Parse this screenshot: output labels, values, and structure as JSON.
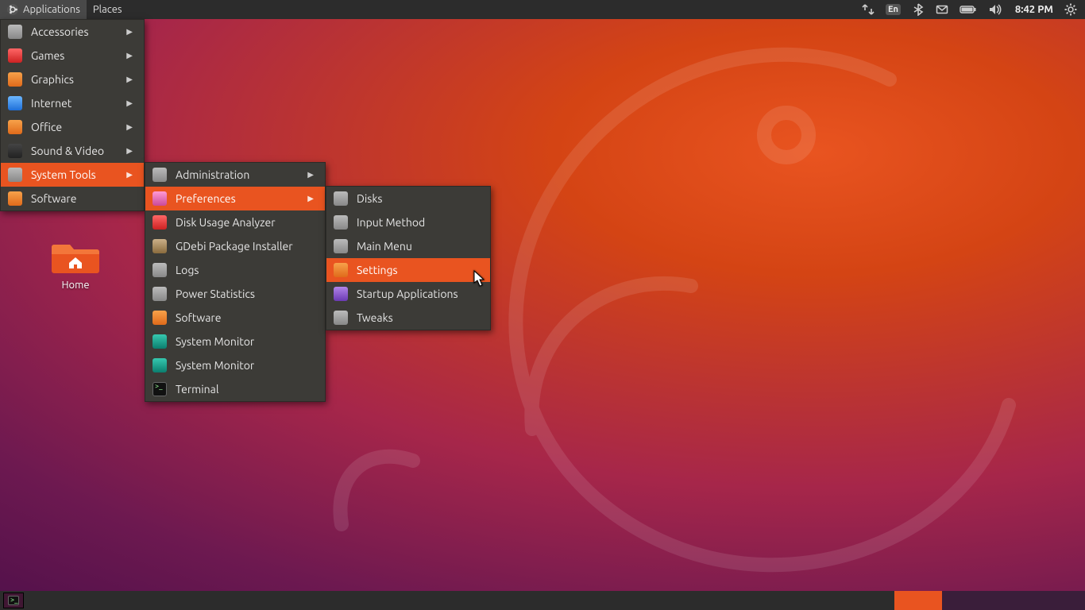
{
  "topbar": {
    "applications": "Applications",
    "places": "Places",
    "lang": "En",
    "clock": "8:42 PM"
  },
  "desktop": {
    "home_label": "Home"
  },
  "apps_menu": {
    "items": [
      {
        "label": "Accessories",
        "arrow": true,
        "icon": "ic-grey"
      },
      {
        "label": "Games",
        "arrow": true,
        "icon": "ic-red"
      },
      {
        "label": "Graphics",
        "arrow": true,
        "icon": "ic-orange"
      },
      {
        "label": "Internet",
        "arrow": true,
        "icon": "ic-blue"
      },
      {
        "label": "Office",
        "arrow": true,
        "icon": "ic-orange"
      },
      {
        "label": "Sound & Video",
        "arrow": true,
        "icon": "ic-dark"
      },
      {
        "label": "System Tools",
        "arrow": true,
        "icon": "ic-grey",
        "highlight": true
      },
      {
        "label": "Software",
        "arrow": false,
        "icon": "ic-orange"
      }
    ]
  },
  "systools_menu": {
    "items": [
      {
        "label": "Administration",
        "arrow": true,
        "icon": "ic-grey"
      },
      {
        "label": "Preferences",
        "arrow": true,
        "icon": "ic-pink",
        "highlight": true
      },
      {
        "label": "Disk Usage Analyzer",
        "arrow": false,
        "icon": "ic-red"
      },
      {
        "label": "GDebi Package Installer",
        "arrow": false,
        "icon": "ic-brown"
      },
      {
        "label": "Logs",
        "arrow": false,
        "icon": "ic-grey"
      },
      {
        "label": "Power Statistics",
        "arrow": false,
        "icon": "ic-grey"
      },
      {
        "label": "Software",
        "arrow": false,
        "icon": "ic-orange"
      },
      {
        "label": "System Monitor",
        "arrow": false,
        "icon": "ic-teal"
      },
      {
        "label": "System Monitor",
        "arrow": false,
        "icon": "ic-teal"
      },
      {
        "label": "Terminal",
        "arrow": false,
        "icon": "ic-term"
      }
    ]
  },
  "prefs_menu": {
    "items": [
      {
        "label": "Disks",
        "icon": "ic-grey"
      },
      {
        "label": "Input Method",
        "icon": "ic-grey"
      },
      {
        "label": "Main Menu",
        "icon": "ic-grey"
      },
      {
        "label": "Settings",
        "icon": "ic-orange",
        "highlight": true
      },
      {
        "label": "Startup Applications",
        "icon": "ic-purple"
      },
      {
        "label": "Tweaks",
        "icon": "ic-grey"
      }
    ]
  }
}
